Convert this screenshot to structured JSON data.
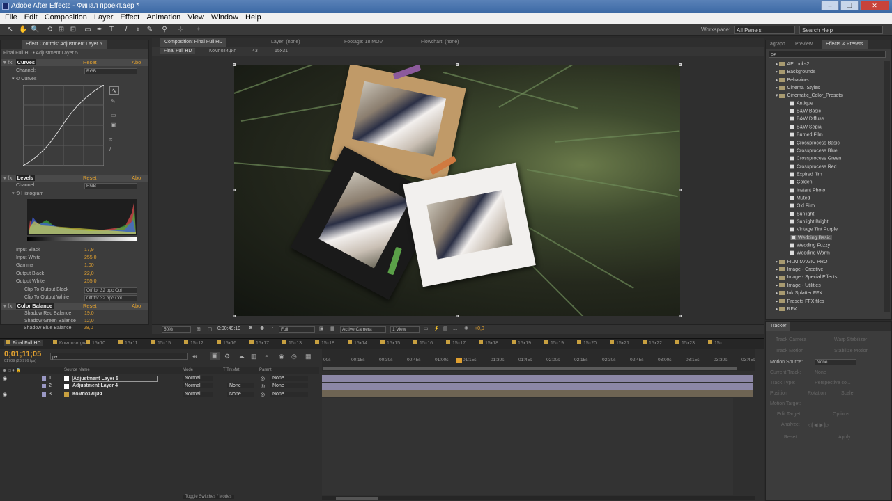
{
  "window": {
    "title": "Adobe After Effects - Финал проект.aep *",
    "buttons": [
      "–",
      "❐",
      "✕"
    ]
  },
  "menu": [
    "File",
    "Edit",
    "Composition",
    "Layer",
    "Effect",
    "Animation",
    "View",
    "Window",
    "Help"
  ],
  "toolbar": {
    "workspace_label": "Workspace:",
    "workspace_value": "All Panels",
    "search_placeholder": "Search Help",
    "tools": [
      "↖",
      "✋",
      "🔍",
      "⟲",
      "⊞",
      "⊡",
      "▭",
      "✒",
      "T",
      "/",
      "⌖",
      "✎",
      "⚲",
      "⊹",
      "✦"
    ]
  },
  "effect_controls": {
    "tab": "Effect Controls: Adjustment Layer 5",
    "subtitle": "Final Full HD • Adjustment Layer 5",
    "curves": {
      "name": "Curves",
      "reset": "Reset",
      "about": "Abo",
      "channel_label": "Channel:",
      "channel_value": "RGB",
      "curves_label": "Curves"
    },
    "levels": {
      "name": "Levels",
      "reset": "Reset",
      "about": "Abo",
      "channel_label": "Channel:",
      "channel_value": "RGB",
      "histogram_label": "Histogram",
      "params": [
        {
          "label": "Input Black",
          "value": "17,9"
        },
        {
          "label": "Input White",
          "value": "255,0"
        },
        {
          "label": "Gamma",
          "value": "1,00"
        },
        {
          "label": "Output Black",
          "value": "22,0"
        },
        {
          "label": "Output White",
          "value": "255,0"
        }
      ],
      "clip_black": {
        "label": "Clip To Output Black",
        "value": "Off for 32 bpc Col"
      },
      "clip_white": {
        "label": "Clip To Output White",
        "value": "Off for 32 bpc Col"
      }
    },
    "color_balance": {
      "name": "Color Balance",
      "reset": "Reset",
      "about": "Abo",
      "params": [
        {
          "label": "Shadow Red Balance",
          "value": "19,0"
        },
        {
          "label": "Shadow Green Balance",
          "value": "12,0"
        },
        {
          "label": "Shadow Blue Balance",
          "value": "28,0"
        }
      ]
    }
  },
  "viewer": {
    "tabs": [
      "Composition: Final Full HD",
      "Layer: (none)",
      "Footage: 18.MOV",
      "Flowchart: (none)"
    ],
    "breadcrumbs": [
      "Final Full HD",
      "Композиция",
      "43",
      "15x31"
    ],
    "zoom": "50%",
    "timecode": "0:00:49:19",
    "resolution": "Full",
    "camera": "Active Camera",
    "views": "1 View",
    "exposure": "+0,0"
  },
  "right_panel": {
    "tabs": [
      "agraph",
      "Preview",
      "Effects & Presets"
    ],
    "search_placeholder": "ρ▾",
    "tree": [
      {
        "label": "AELooks2",
        "type": "folder"
      },
      {
        "label": "Backgrounds",
        "type": "folder"
      },
      {
        "label": "Behaviors",
        "type": "folder"
      },
      {
        "label": "Cinema_Styles",
        "type": "folder"
      },
      {
        "label": "Cinematic_Color_Presets",
        "type": "folder-open"
      },
      {
        "label": "Antique",
        "type": "preset"
      },
      {
        "label": "B&W Basic",
        "type": "preset"
      },
      {
        "label": "B&W Diffuse",
        "type": "preset"
      },
      {
        "label": "B&W Sepia",
        "type": "preset"
      },
      {
        "label": "Burned Film",
        "type": "preset"
      },
      {
        "label": "Crossprocess Basic",
        "type": "preset"
      },
      {
        "label": "Crossprocess Blue",
        "type": "preset"
      },
      {
        "label": "Crossprocess Green",
        "type": "preset"
      },
      {
        "label": "Crossprocess Red",
        "type": "preset"
      },
      {
        "label": "Expired film",
        "type": "preset"
      },
      {
        "label": "Golden",
        "type": "preset"
      },
      {
        "label": "Instant Photo",
        "type": "preset"
      },
      {
        "label": "Muted",
        "type": "preset"
      },
      {
        "label": "Old Film",
        "type": "preset"
      },
      {
        "label": "Sunlight",
        "type": "preset"
      },
      {
        "label": "Sunlight Bright",
        "type": "preset"
      },
      {
        "label": "Vintage Tint Purple",
        "type": "preset"
      },
      {
        "label": "Wedding Basic",
        "type": "preset",
        "selected": true
      },
      {
        "label": "Wedding Fuzzy",
        "type": "preset"
      },
      {
        "label": "Wedding Warm",
        "type": "preset"
      },
      {
        "label": "FILM MAGIC PRO",
        "type": "folder"
      },
      {
        "label": "Image - Creative",
        "type": "folder"
      },
      {
        "label": "Image - Special Effects",
        "type": "folder"
      },
      {
        "label": "Image - Utilities",
        "type": "folder"
      },
      {
        "label": "Ink Splatter FFX",
        "type": "folder"
      },
      {
        "label": "Presets FFX files",
        "type": "folder"
      },
      {
        "label": "RFX",
        "type": "folder"
      }
    ]
  },
  "tracker": {
    "tab": "Tracker",
    "track_camera": "Track Camera",
    "warp_stabilizer": "Warp Stabilizer",
    "track_motion": "Track Motion",
    "stabilize_motion": "Stabilize Motion",
    "motion_source_label": "Motion Source:",
    "motion_source_value": "None",
    "current_track_label": "Current Track:",
    "current_track_value": "None",
    "track_type_label": "Track Type:",
    "track_type_value": "Perspective co...",
    "position": "Position",
    "rotation": "Rotation",
    "scale": "Scale",
    "motion_target": "Motion Target:",
    "edit_target": "Edit Target...",
    "options": "Options...",
    "analyze": "Analyze:",
    "reset": "Reset",
    "apply": "Apply"
  },
  "timeline": {
    "tabs": [
      "Final Full HD",
      "Композиция",
      "15x10",
      "15x11",
      "15x15",
      "15x12",
      "15x16",
      "15x17",
      "15x13",
      "15x18",
      "15x14",
      "15x15",
      "15x16",
      "15x17",
      "15x18",
      "15x19",
      "15x19",
      "15x20",
      "15x21",
      "15x22",
      "15x23",
      "15x"
    ],
    "timecode": "0;01;11;05",
    "fps": "01709 (23.976 fps)",
    "columns": [
      "Source Name",
      "Mode",
      "T TrkMat",
      "Parent"
    ],
    "layers": [
      {
        "num": "1",
        "name": "Adjustment Layer 5",
        "mode": "Normal",
        "trkmat": "",
        "parent": "None"
      },
      {
        "num": "2",
        "name": "Adjustment Layer 4",
        "mode": "Normal",
        "trkmat": "None",
        "parent": "None"
      },
      {
        "num": "3",
        "name": "Композиция",
        "mode": "Normal",
        "trkmat": "None",
        "parent": "None"
      }
    ],
    "ruler": [
      "00s",
      "00:15s",
      "00:30s",
      "00:45s",
      "01:00s",
      "01:15s",
      "01:30s",
      "01:45s",
      "02:00s",
      "02:15s",
      "02:30s",
      "02:45s",
      "03:00s",
      "03:15s",
      "03:30s",
      "03:45s"
    ],
    "playhead_fraction": 0.315,
    "toggle_label": "Toggle Switches / Modes"
  },
  "colors": {
    "accent": "#e0a030",
    "layer_bar": "#8c87a6",
    "comp_bar": "#6e6453",
    "playhead": "#d02020"
  }
}
